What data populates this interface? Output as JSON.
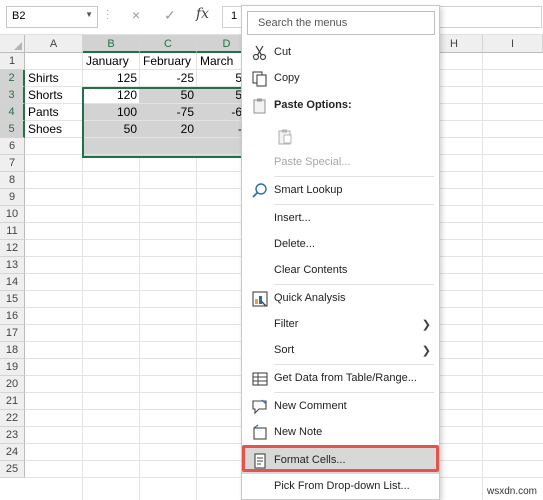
{
  "formula_bar": {
    "name_box": "B2",
    "cancel_icon": "×",
    "enter_icon": "✓",
    "fx": "fx",
    "content": "1"
  },
  "columns": [
    "A",
    "B",
    "C",
    "D",
    "H",
    "I"
  ],
  "rows": [
    "1",
    "2",
    "3",
    "4",
    "5",
    "6",
    "7",
    "8",
    "9",
    "10",
    "11",
    "12",
    "13",
    "14",
    "15",
    "16",
    "17",
    "18",
    "19",
    "20",
    "21",
    "22",
    "23",
    "24",
    "25"
  ],
  "cells": {
    "b1": "January",
    "c1": "February",
    "d1": "March",
    "a2": "Shirts",
    "b2": "125",
    "c2": "-25",
    "d2": "5",
    "a3": "Shorts",
    "b3": "120",
    "c3": "50",
    "d3": "5",
    "a4": "Pants",
    "b4": "100",
    "c4": "-75",
    "d4": "-6",
    "a5": "Shoes",
    "b5": "50",
    "c5": "20",
    "d5": "-"
  },
  "menu": {
    "search_placeholder": "Search the menus",
    "cut": "Cut",
    "copy": "Copy",
    "paste_options": "Paste Options:",
    "paste_special": "Paste Special...",
    "smart_lookup": "Smart Lookup",
    "insert": "Insert...",
    "delete": "Delete...",
    "clear_contents": "Clear Contents",
    "quick_analysis": "Quick Analysis",
    "filter": "Filter",
    "sort": "Sort",
    "get_data": "Get Data from Table/Range...",
    "new_comment": "New Comment",
    "new_note": "New Note",
    "format_cells": "Format Cells...",
    "pick_list": "Pick From Drop-down List..."
  },
  "colors": {
    "accent": "#217346",
    "highlight": "#e3544d"
  },
  "watermark": "wsxdn.com"
}
